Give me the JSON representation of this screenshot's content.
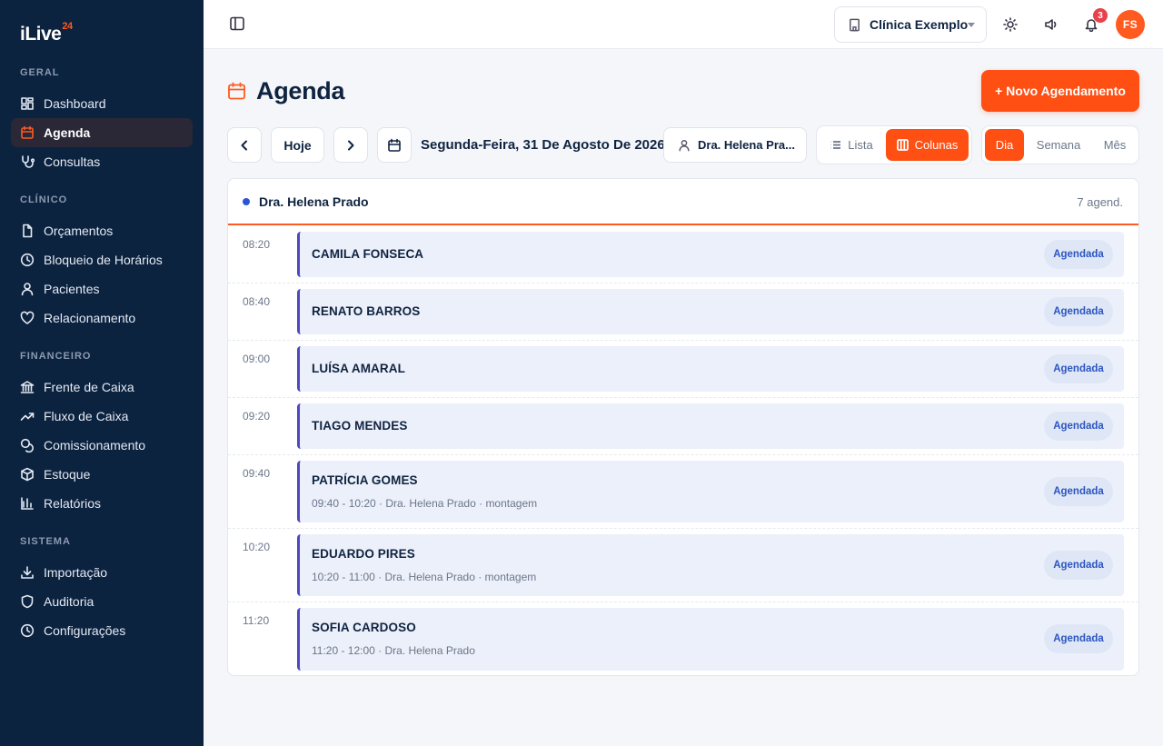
{
  "app": {
    "logo_text": "iLive",
    "logo_sup": "24"
  },
  "sidebar": {
    "sections": [
      {
        "title": "GERAL",
        "items": [
          {
            "label": "Dashboard",
            "icon": "dashboard-icon",
            "active": false
          },
          {
            "label": "Agenda",
            "icon": "calendar-icon",
            "active": true
          },
          {
            "label": "Consultas",
            "icon": "stethoscope-icon",
            "active": false
          }
        ]
      },
      {
        "title": "CLÍNICO",
        "items": [
          {
            "label": "Orçamentos",
            "icon": "file-icon",
            "active": false
          },
          {
            "label": "Bloqueio de Horários",
            "icon": "clock-icon",
            "active": false
          },
          {
            "label": "Pacientes",
            "icon": "user-icon",
            "active": false
          },
          {
            "label": "Relacionamento",
            "icon": "heart-icon",
            "active": false
          }
        ]
      },
      {
        "title": "FINANCEIRO",
        "items": [
          {
            "label": "Frente de Caixa",
            "icon": "bank-icon",
            "active": false
          },
          {
            "label": "Fluxo de Caixa",
            "icon": "trend-up-icon",
            "active": false
          },
          {
            "label": "Comissionamento",
            "icon": "coins-icon",
            "active": false
          },
          {
            "label": "Estoque",
            "icon": "box-icon",
            "active": false
          },
          {
            "label": "Relatórios",
            "icon": "bar-chart-icon",
            "active": false
          }
        ]
      },
      {
        "title": "SISTEMA",
        "items": [
          {
            "label": "Importação",
            "icon": "download-icon",
            "active": false
          },
          {
            "label": "Auditoria",
            "icon": "shield-icon",
            "active": false
          },
          {
            "label": "Configurações",
            "icon": "clock-icon",
            "active": false
          }
        ]
      }
    ]
  },
  "topbar": {
    "clinic": "Clínica Exemplo",
    "notifications": "3",
    "avatar_initials": "FS"
  },
  "page": {
    "title": "Agenda",
    "new_button": "+ Novo Agendamento"
  },
  "toolbar": {
    "today": "Hoje",
    "date": "Segunda-Feira, 31 De Agosto De 2026",
    "professional": "Dra. Helena Pra...",
    "view_list": "Lista",
    "view_columns": "Colunas",
    "range_day": "Dia",
    "range_week": "Semana",
    "range_month": "Mês"
  },
  "schedule": {
    "doctor": "Dra. Helena Prado",
    "count": "7 agend.",
    "rows": [
      {
        "time": "08:20",
        "patient": "CAMILA FONSECA",
        "detail": "",
        "status": "Agendada"
      },
      {
        "time": "08:40",
        "patient": "RENATO BARROS",
        "detail": "",
        "status": "Agendada"
      },
      {
        "time": "09:00",
        "patient": "LUÍSA AMARAL",
        "detail": "",
        "status": "Agendada"
      },
      {
        "time": "09:20",
        "patient": "TIAGO MENDES",
        "detail": "",
        "status": "Agendada"
      },
      {
        "time": "09:40",
        "patient": "PATRÍCIA GOMES",
        "detail": "09:40 - 10:20 · Dra. Helena Prado · montagem",
        "status": "Agendada"
      },
      {
        "time": "10:20",
        "patient": "EDUARDO PIRES",
        "detail": "10:20 - 11:00 · Dra. Helena Prado · montagem",
        "status": "Agendada"
      },
      {
        "time": "11:20",
        "patient": "SOFIA CARDOSO",
        "detail": "11:20 - 12:00 · Dra. Helena Prado",
        "status": "Agendada"
      }
    ]
  },
  "colors": {
    "accent": "#ff4f12",
    "sidebar_bg": "#0c2340",
    "status_text": "#2b55c0"
  }
}
